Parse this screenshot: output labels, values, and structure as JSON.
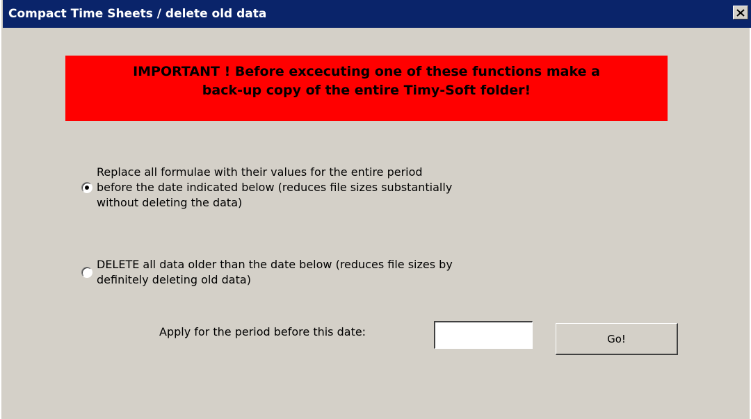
{
  "window": {
    "title": "Compact Time Sheets / delete old data",
    "close_icon": "close-icon"
  },
  "warning": {
    "line1": "IMPORTANT ! Before excecuting one of these functions make a",
    "line2": "back-up copy of the entire Timy-Soft folder!",
    "background_color": "#ff0000"
  },
  "options": [
    {
      "selected": true,
      "lines": [
        "Replace all formulae with their values for the entire period",
        "before the date indicated below (reduces file sizes substantially",
        "without deleting the data)"
      ]
    },
    {
      "selected": false,
      "lines": [
        "DELETE all data older than the date below (reduces file sizes by",
        "definitely deleting old data)"
      ]
    }
  ],
  "date": {
    "label": "Apply for the period before this date:",
    "value": ""
  },
  "go_button": {
    "label": "Go!"
  },
  "colors": {
    "titlebar": "#0a246a",
    "dialog_face": "#d4d0c8"
  }
}
